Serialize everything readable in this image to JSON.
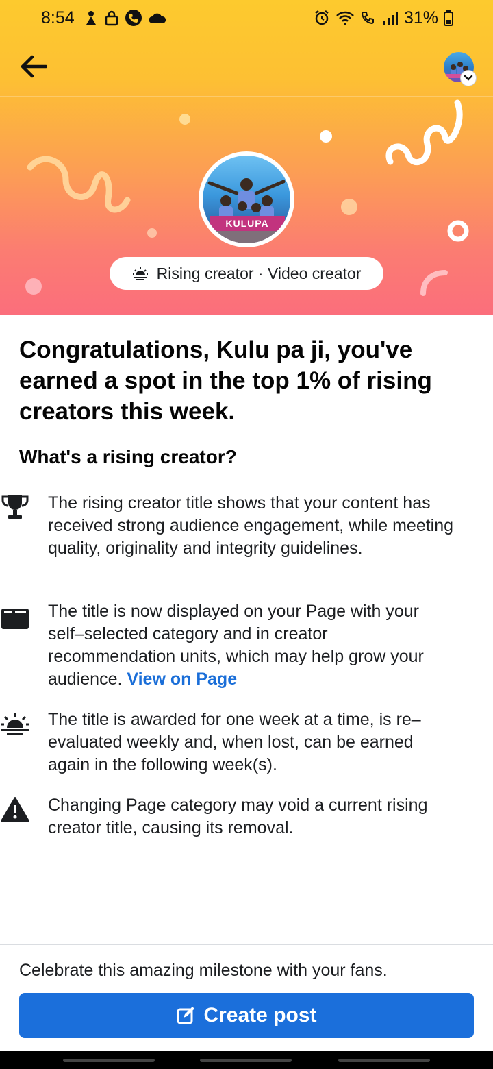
{
  "status": {
    "time": "8:54",
    "battery": "31%"
  },
  "badge": {
    "label": "Rising creator · Video creator"
  },
  "profile": {
    "banner_text": "KULUPA"
  },
  "headline": "Congratulations, Kulu pa ji, you've earned a spot in the top 1% of rising creators this week.",
  "subhead": "What's a rising creator?",
  "features": [
    {
      "icon": "trophy-icon",
      "text": "The rising creator title shows that your content has received strong audience engagement, while meeting quality, originality and integrity guidelines."
    },
    {
      "icon": "page-icon",
      "text": "The title is now displayed on your Page with your self–selected category and in creator recommendation units, which may help grow your audience.",
      "link": "View on Page"
    },
    {
      "icon": "sunrise-icon",
      "text": "The title is awarded for one week at a time, is re–evaluated weekly and, when lost, can be earned again in the following week(s)."
    },
    {
      "icon": "warning-icon",
      "text": "Changing Page category may void a current rising creator title, causing its removal."
    }
  ],
  "footer": {
    "text": "Celebrate this amazing milestone with your fans.",
    "button_label": "Create post"
  },
  "colors": {
    "accent": "#1b6fdb",
    "hero_top": "#fdca2e",
    "hero_bottom": "#fb6e7c"
  }
}
